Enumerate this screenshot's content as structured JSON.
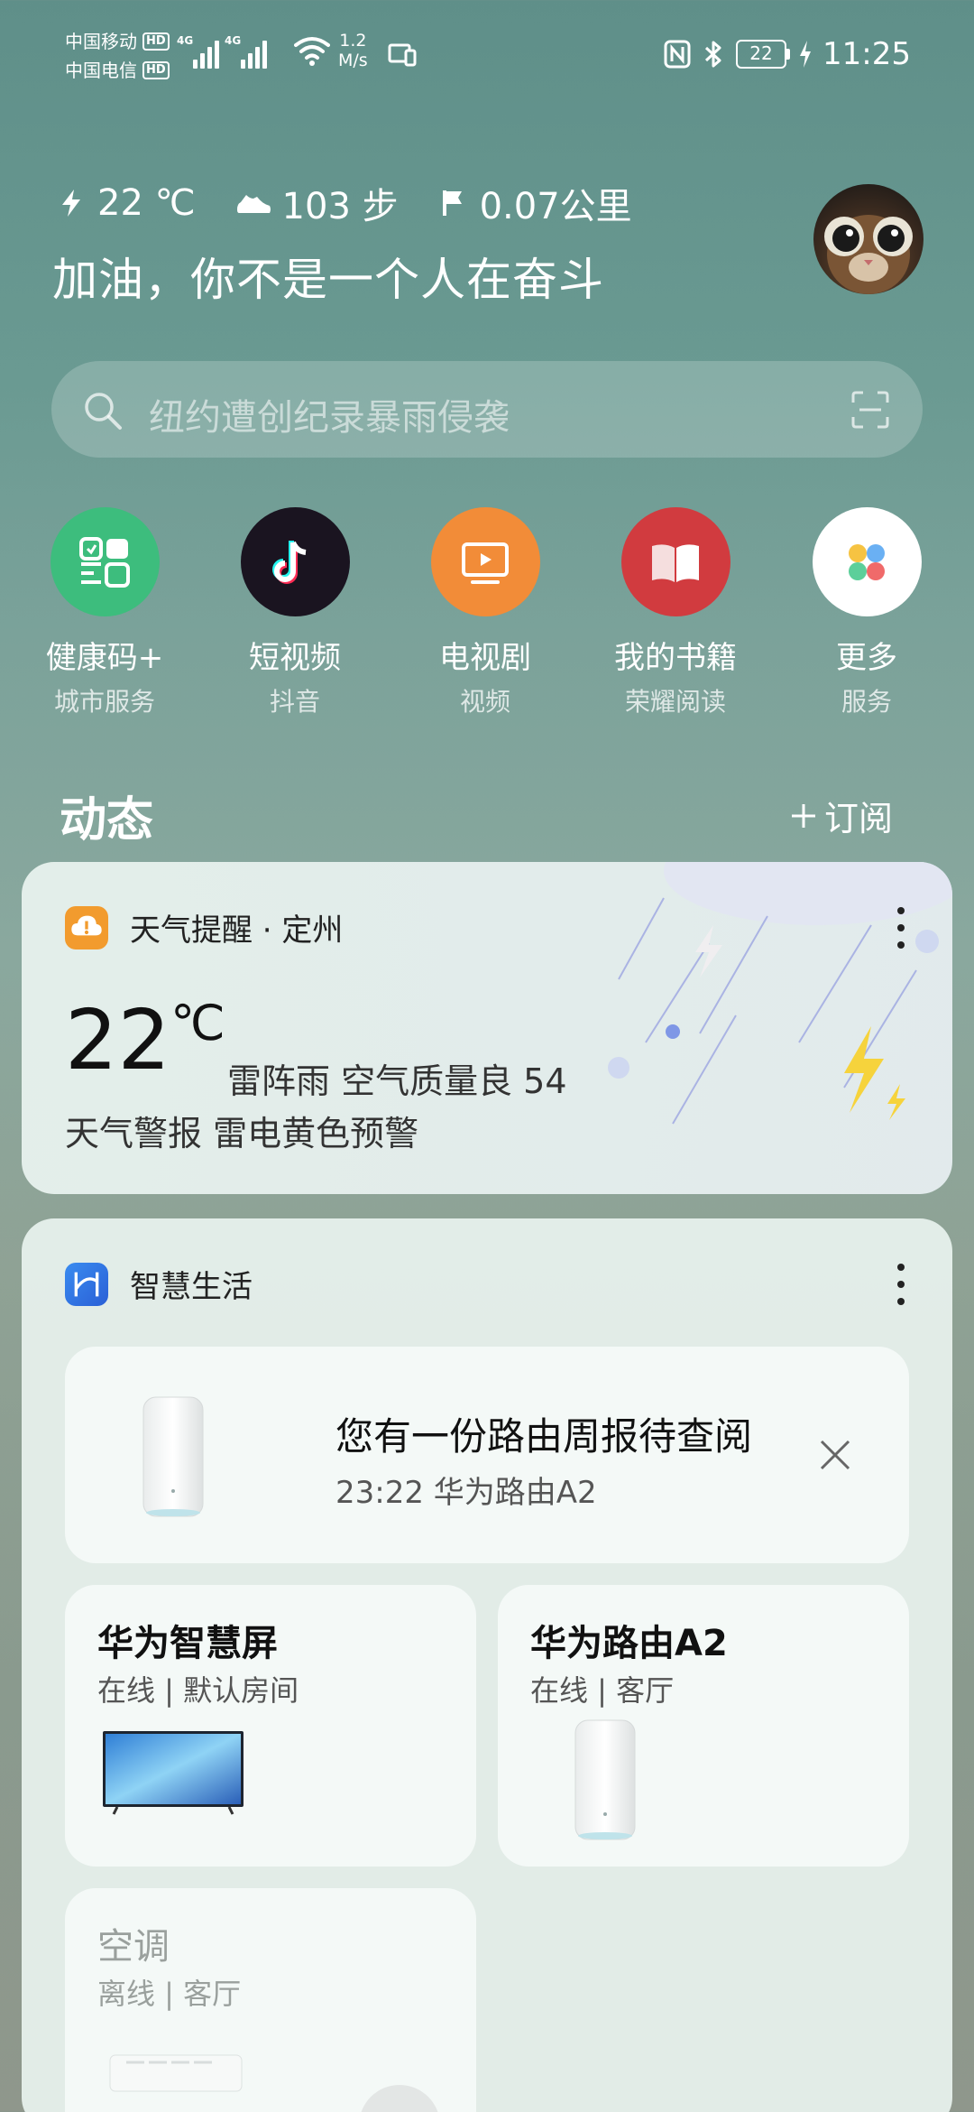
{
  "status_bar": {
    "carrier1": "中国移动",
    "carrier2": "中国电信",
    "hd": "HD",
    "net_tag": "4G",
    "speed_value": "1.2",
    "speed_unit": "M/s",
    "battery": "22",
    "time": "11:25"
  },
  "stats": {
    "temperature": "22 ℃",
    "steps": "103 步",
    "distance": "0.07公里"
  },
  "motto": "加油，你不是一个人在奋斗",
  "search": {
    "placeholder": "纽约遭创纪录暴雨侵袭"
  },
  "apps": [
    {
      "label": "健康码+",
      "sub": "城市服务",
      "color": "#3dbd7d",
      "icon": "health-code-icon"
    },
    {
      "label": "短视频",
      "sub": "抖音",
      "color": "#1a1420",
      "icon": "tiktok-icon"
    },
    {
      "label": "电视剧",
      "sub": "视频",
      "color": "#f28c38",
      "icon": "tv-icon"
    },
    {
      "label": "我的书籍",
      "sub": "荣耀阅读",
      "color": "#d13b3f",
      "icon": "book-icon"
    },
    {
      "label": "更多",
      "sub": "服务",
      "color": "#ffffff",
      "icon": "more-apps-icon"
    }
  ],
  "feed": {
    "title": "动态",
    "subscribe": "订阅"
  },
  "weather_card": {
    "title": "天气提醒 · 定州",
    "temp": "22",
    "temp_unit": "℃",
    "desc": "雷阵雨  空气质量良  54",
    "alert": "天气警报 雷电黄色预警"
  },
  "life_card": {
    "title": "智慧生活",
    "notice_title": "您有一份路由周报待查阅",
    "notice_sub": "23:22 华为路由A2",
    "devices": [
      {
        "name": "华为智慧屏",
        "status": "在线 | 默认房间"
      },
      {
        "name": "华为路由A2",
        "status": "在线 | 客厅"
      },
      {
        "name": "空调",
        "status": "离线 | 客厅"
      }
    ]
  }
}
